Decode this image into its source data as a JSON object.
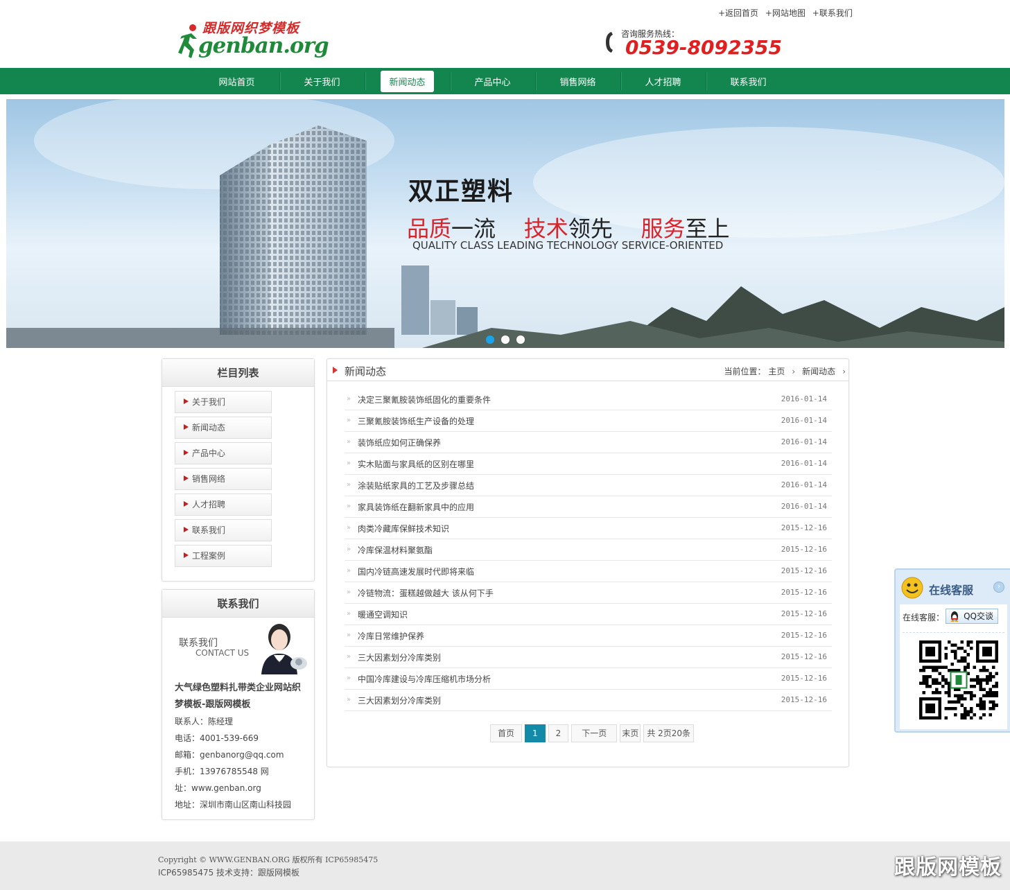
{
  "header": {
    "top_links": [
      "+返回首页",
      "+网站地图",
      "+联系我们"
    ],
    "logo_cn": "跟版网织梦模板",
    "logo_en": "genban.org",
    "hotline_label": "咨询服务热线：",
    "hotline_number": "0539-8092355"
  },
  "nav": {
    "items": [
      "网站首页",
      "关于我们",
      "新闻动态",
      "产品中心",
      "销售网络",
      "人才招聘",
      "联系我们"
    ],
    "active": "新闻动态"
  },
  "banner": {
    "title": "双正塑料",
    "slogan": [
      {
        "red": "品质",
        "black": "一流"
      },
      {
        "red": "技术",
        "black": "领先"
      },
      {
        "red": "服务",
        "black": "至上"
      }
    ],
    "slogan_en": "QUALITY CLASS LEADING TECHNOLOGY SERVICE-ORIENTED",
    "dots_active_index": 0,
    "dots_count": 3
  },
  "sidebar": {
    "category_title": "栏目列表",
    "categories": [
      "关于我们",
      "新闻动态",
      "产品中心",
      "销售网络",
      "人才招聘",
      "联系我们",
      "工程案例"
    ],
    "contact_title": "联系我们",
    "contact_img_cn": "联系我们",
    "contact_img_en": "CONTACT US",
    "company": "大气绿色塑料扎带类企业网站织梦模板-跟版网模板",
    "lines": [
      "联系人：陈经理",
      "电话：4001-539-669",
      "邮箱：genbanorg@qq.com",
      "手机：13976785548 网",
      "址：www.genban.org",
      "地址：深圳市南山区南山科技园"
    ]
  },
  "main": {
    "title": "新闻动态",
    "breadcrumb_label": "当前位置：",
    "breadcrumb": [
      "主页",
      "新闻动态"
    ],
    "news": [
      {
        "title": "决定三聚氰胺装饰纸固化的重要条件",
        "date": "2016-01-14"
      },
      {
        "title": "三聚氰胺装饰纸生产设备的处理",
        "date": "2016-01-14"
      },
      {
        "title": "装饰纸应如何正确保养",
        "date": "2016-01-14"
      },
      {
        "title": "实木贴面与家具纸的区别在哪里",
        "date": "2016-01-14"
      },
      {
        "title": "涂装贴纸家具的工艺及步骤总结",
        "date": "2016-01-14"
      },
      {
        "title": "家具装饰纸在翻新家具中的应用",
        "date": "2016-01-14"
      },
      {
        "title": "肉类冷藏库保鲜技术知识",
        "date": "2015-12-16"
      },
      {
        "title": "冷库保温材料聚氨酯",
        "date": "2015-12-16"
      },
      {
        "title": "国内冷链高速发展时代即将来临",
        "date": "2015-12-16"
      },
      {
        "title": "冷链物流：蛋糕越做越大 该从何下手",
        "date": "2015-12-16"
      },
      {
        "title": "暖通空调知识",
        "date": "2015-12-16"
      },
      {
        "title": "冷库日常维护保养",
        "date": "2015-12-16"
      },
      {
        "title": "三大因素划分冷库类别",
        "date": "2015-12-16"
      },
      {
        "title": "中国冷库建设与冷库压缩机市场分析",
        "date": "2015-12-16"
      },
      {
        "title": "三大因素划分冷库类别",
        "date": "2015-12-16"
      }
    ],
    "pager": {
      "first": "首页",
      "pages": [
        "1",
        "2"
      ],
      "current": "1",
      "next": "下一页",
      "last": "末页",
      "info": "共 2页20条"
    }
  },
  "float_service": {
    "title": "在线客服",
    "label": "在线客服：",
    "qq_button": "QQ交谈"
  },
  "footer": {
    "line1": "Copyright © WWW.GENBAN.ORG 版权所有 ICP65985475",
    "line2": "ICP65985475 技术支持：跟版网模板",
    "watermark": "跟版网模板"
  },
  "colors": {
    "nav_green": "#13864f",
    "hotline_red": "#e02020",
    "pager_current": "#138aa8",
    "dot_active": "#1aa3e8"
  }
}
